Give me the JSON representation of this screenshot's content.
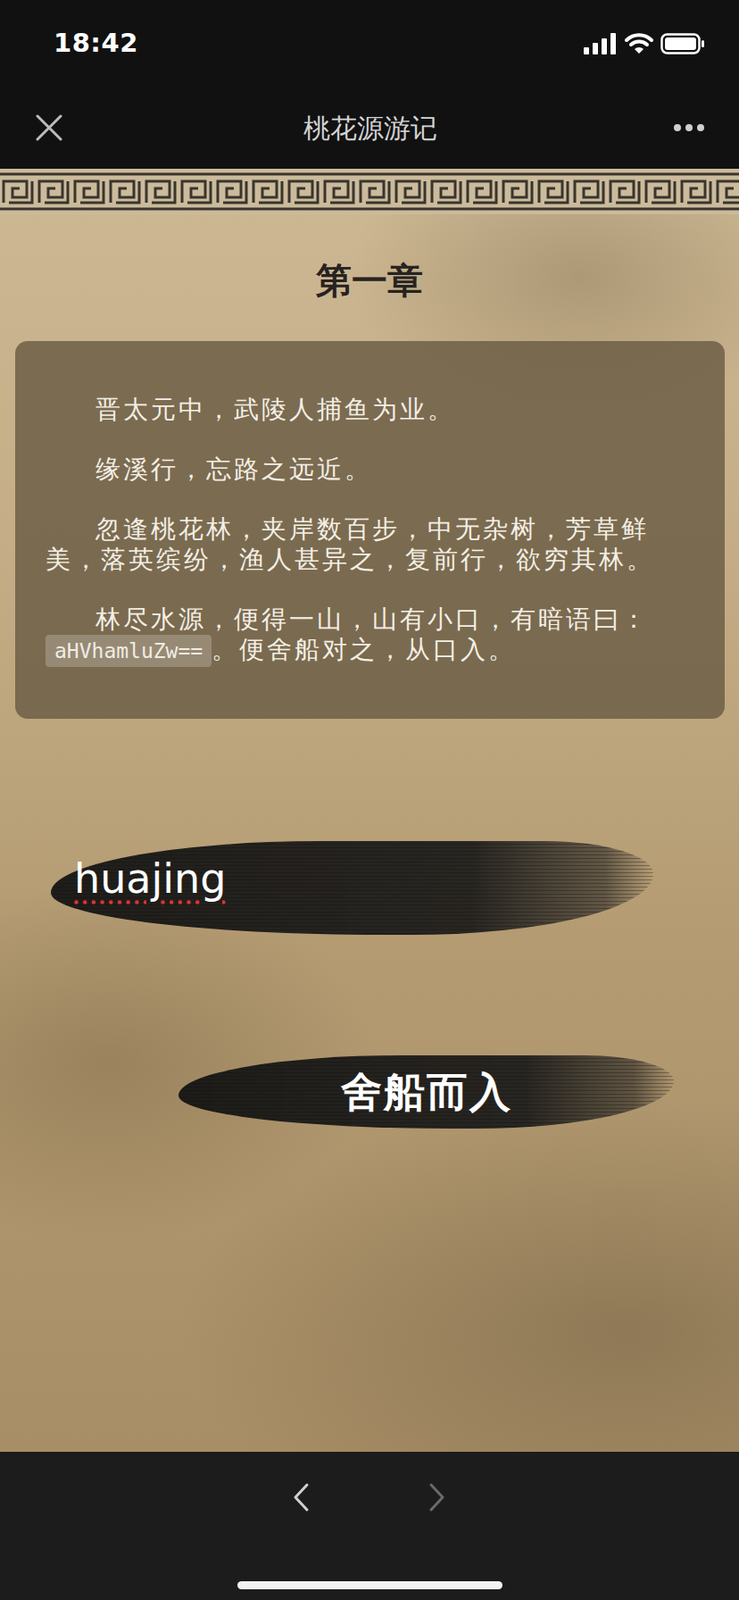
{
  "status_bar": {
    "time": "18:42"
  },
  "nav": {
    "title": "桃花源游记"
  },
  "chapter": {
    "title": "第一章",
    "paragraphs": [
      {
        "segments": [
          {
            "kind": "text",
            "text": "晋太元中，武陵人捕鱼为业。"
          }
        ]
      },
      {
        "segments": [
          {
            "kind": "text",
            "text": "缘溪行，忘路之远近。"
          }
        ]
      },
      {
        "segments": [
          {
            "kind": "text",
            "text": "忽逢桃花林，夹岸数百步，中无杂树，芳草鲜美，落英缤纷，渔人甚异之，复前行，欲穷其林。"
          }
        ]
      },
      {
        "segments": [
          {
            "kind": "text",
            "text": "林尽水源，便得一山，山有小口，有暗语曰："
          },
          {
            "kind": "code",
            "text": "aHVhamluZw=="
          },
          {
            "kind": "text",
            "text": "。便舍船对之，从口入。"
          }
        ]
      }
    ]
  },
  "answer": {
    "value": "huajing"
  },
  "submit": {
    "label": "舍船而入"
  },
  "toolbar": {
    "back": {
      "disabled": false
    },
    "forward": {
      "disabled": true
    }
  }
}
